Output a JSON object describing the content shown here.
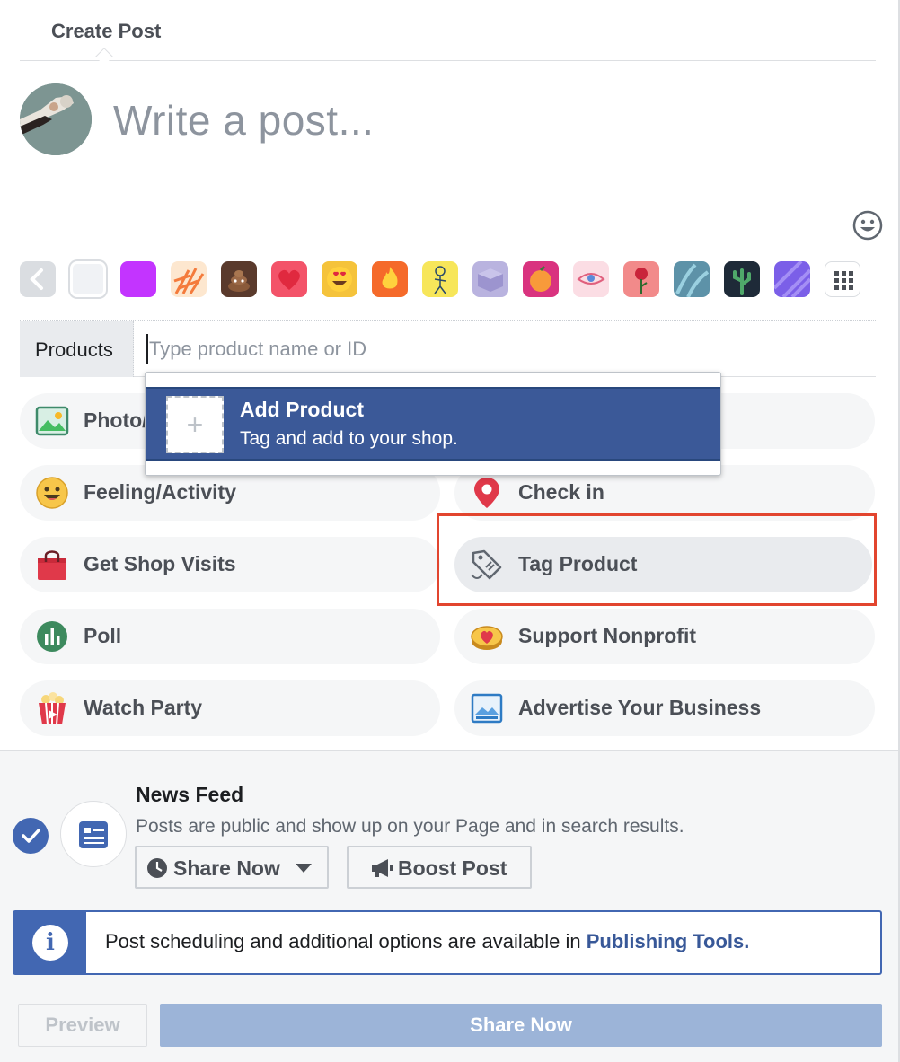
{
  "header": {
    "title": "Create Post"
  },
  "composer": {
    "placeholder": "Write a post..."
  },
  "backgrounds": {
    "icons": [
      "chevron-left-icon",
      "plain-white",
      "solid-purple",
      "orange-leaves",
      "poop-emoji",
      "heart",
      "heart-eyes-emoji",
      "fire",
      "yellow-doodle",
      "purple-cube",
      "orange-fruit",
      "eye",
      "rose",
      "blue-leaves",
      "cactus",
      "purple-pattern",
      "grid-icon"
    ]
  },
  "products": {
    "label": "Products",
    "placeholder": "Type product name or ID"
  },
  "dropdown": {
    "title": "Add Product",
    "subtitle": "Tag and add to your shop."
  },
  "options": {
    "photo": "Photo/Video",
    "feeling": "Feeling/Activity",
    "checkin": "Check in",
    "shop": "Get Shop Visits",
    "tag": "Tag Product",
    "poll": "Poll",
    "nonprofit": "Support Nonprofit",
    "watch": "Watch Party",
    "advertise": "Advertise Your Business"
  },
  "newsfeed": {
    "title": "News Feed",
    "description": "Posts are public and show up on your Page and in search results.",
    "share_now": "Share Now",
    "boost": "Boost Post"
  },
  "info": {
    "text": "Post scheduling and additional options are available in ",
    "link": "Publishing Tools."
  },
  "footer": {
    "preview": "Preview",
    "share": "Share Now"
  },
  "colors": {
    "brand": "#4267b2",
    "dropdown_bg": "#3b5998",
    "highlight": "#e2452f"
  }
}
